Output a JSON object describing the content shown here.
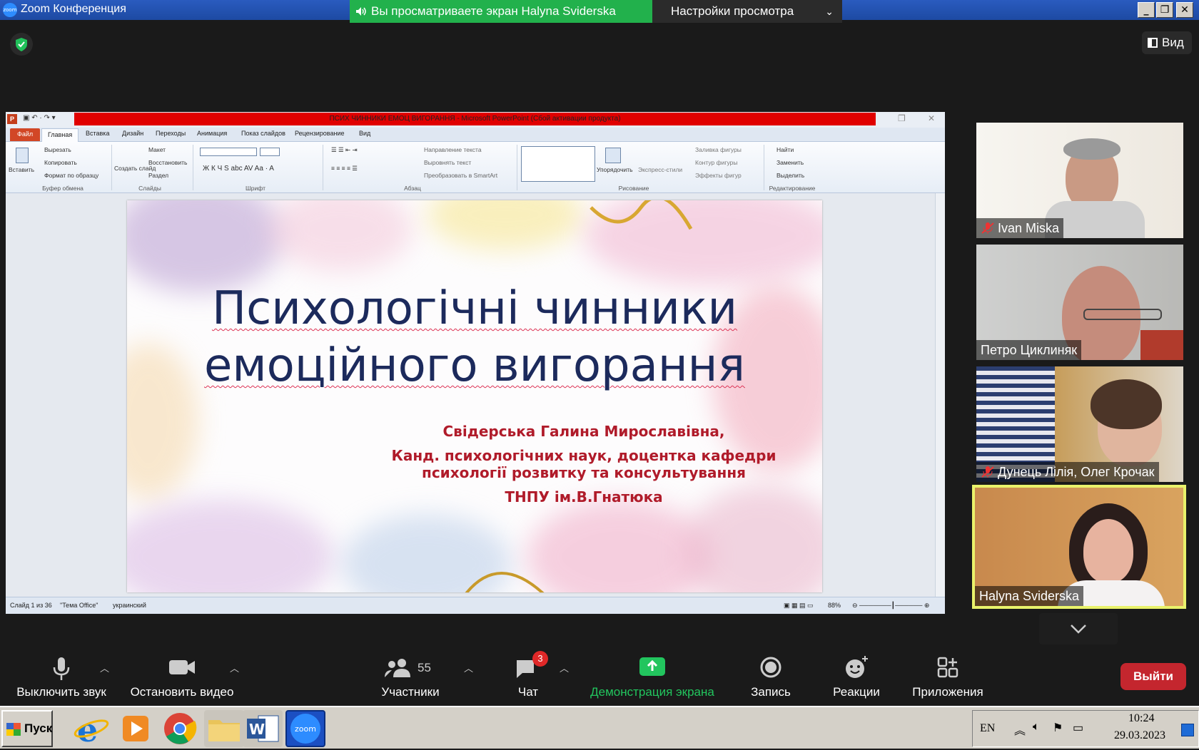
{
  "window": {
    "title": "Zoom Конференция",
    "logo_text": "zoom",
    "controls": [
      "_",
      "❐",
      "✕"
    ]
  },
  "sharing_banner": {
    "viewing_text": "Вы просматриваете экран Halyna Sviderska",
    "options_label": "Настройки просмотра"
  },
  "top_right": {
    "view_label": "Вид"
  },
  "powerpoint": {
    "title_bar": "ПСИХ ЧИННИКИ ЕМОЦ ВИГОРАННЯ - Microsoft PowerPoint (Сбой активации продукта)",
    "tabs": [
      "Файл",
      "Главная",
      "Вставка",
      "Дизайн",
      "Переходы",
      "Анимация",
      "Показ слайдов",
      "Рецензирование",
      "Вид"
    ],
    "active_tab": "Главная",
    "ribbon": {
      "clipboard": {
        "paste": "Вставить",
        "cut": "Вырезать",
        "copy": "Копировать",
        "format": "Формат по образцу",
        "group": "Буфер обмена"
      },
      "slides": {
        "new_slide": "Создать слайд",
        "layout": "Макет",
        "reset": "Восстановить",
        "section": "Раздел",
        "group": "Слайды"
      },
      "font": {
        "group": "Шрифт"
      },
      "paragraph": {
        "text_direction": "Направление текста",
        "align_text": "Выровнять текст",
        "smartart": "Преобразовать в SmartArt",
        "group": "Абзац"
      },
      "drawing": {
        "arrange": "Упорядочить",
        "quick_styles": "Экспресс-стили",
        "fill": "Заливка фигуры",
        "outline": "Контур фигуры",
        "effects": "Эффекты фигур",
        "group": "Рисование"
      },
      "editing": {
        "find": "Найти",
        "replace": "Заменить",
        "select": "Выделить",
        "group": "Редактирование"
      }
    },
    "slide": {
      "title_line1": "Психологічні чинники",
      "title_line2": "емоційного вигорання",
      "author": "Свідерська Галина Мирославівна,",
      "position_line1": "Канд. психологічних наук, доцентка кафедри",
      "position_line2": "психології розвитку та консультування",
      "institution": "ТНПУ ім.В.Гнатюка"
    },
    "status": {
      "slide_info": "Слайд 1 из 36",
      "theme": "\"Тема Office\"",
      "language": "украинский",
      "zoom": "88%"
    }
  },
  "participants": [
    {
      "name": "Ivan Miska",
      "muted": true
    },
    {
      "name": "Петро Циклиняк",
      "muted": false
    },
    {
      "name": "Дунець Лілія, Олег Крочак",
      "muted": true
    },
    {
      "name": "Halyna Sviderska",
      "muted": false,
      "speaking": true
    }
  ],
  "toolbar": {
    "mute": "Выключить звук",
    "video": "Остановить видео",
    "participants": "Участники",
    "participants_count": "55",
    "chat": "Чат",
    "chat_badge": "3",
    "share": "Демонстрация экрана",
    "record": "Запись",
    "reactions": "Реакции",
    "apps": "Приложения",
    "leave": "Выйти"
  },
  "taskbar": {
    "start": "Пуск",
    "apps": [
      "internet-explorer",
      "media-player",
      "chrome",
      "file-explorer",
      "word",
      "zoom"
    ],
    "zoom_label": "zoom",
    "language": "EN",
    "time": "10:24",
    "date": "29.03.2023"
  },
  "colors": {
    "zoom_green": "#22b14c",
    "leave_red": "#c4262e",
    "speaker_border": "#e9f26b",
    "slide_title": "#1c2a5c",
    "slide_author": "#b01b2a"
  }
}
